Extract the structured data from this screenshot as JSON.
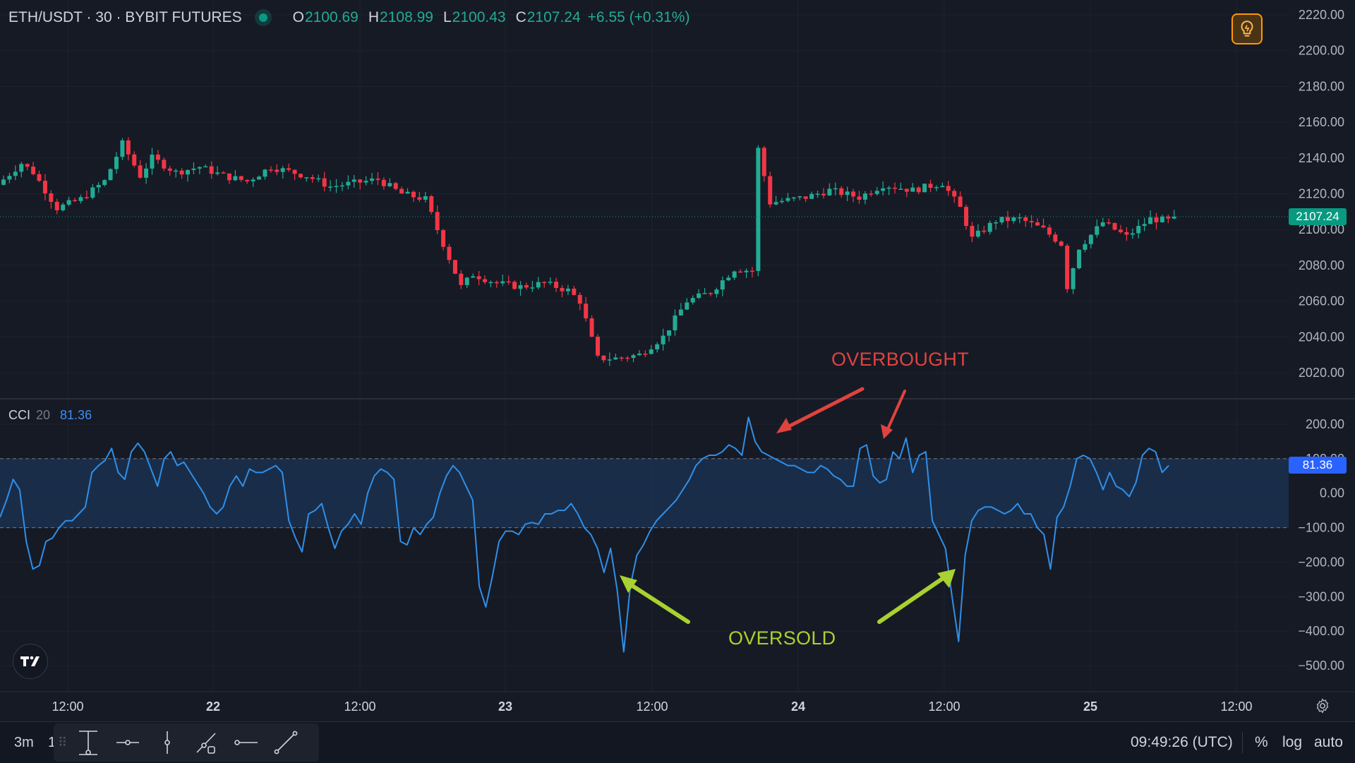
{
  "header": {
    "symbol": "ETH/USDT · 30 · BYBIT FUTURES",
    "open_label": "O",
    "open": "2100.69",
    "high_label": "H",
    "high": "2108.99",
    "low_label": "L",
    "low": "2100.43",
    "close_label": "C",
    "close": "2107.24",
    "change": "+6.55 (+0.31%)"
  },
  "price_axis": {
    "labels": [
      "2220.00",
      "2200.00",
      "2180.00",
      "2160.00",
      "2140.00",
      "2120.00",
      "2100.00",
      "2080.00",
      "2060.00",
      "2040.00",
      "2020.00"
    ],
    "last_price": "2107.24"
  },
  "cci": {
    "name": "CCI",
    "period": "20",
    "value": "81.36",
    "axis_labels": [
      "200.00",
      "100.00",
      "0.00",
      "−100.00",
      "−200.00",
      "−300.00",
      "−400.00",
      "−500.00"
    ]
  },
  "time_axis": {
    "labels": [
      "12:00",
      "22",
      "12:00",
      "23",
      "12:00",
      "24",
      "12:00",
      "25",
      "12:00"
    ]
  },
  "annotations": {
    "overbought": "OVERBOUGHT",
    "oversold": "OVERSOLD"
  },
  "bottom_bar": {
    "timeframes": [
      "3m",
      "1"
    ],
    "clock": "09:49:26 (UTC)",
    "percent": "%",
    "log": "log",
    "auto": "auto"
  },
  "colors": {
    "background": "#161a25",
    "up": "#22ab94",
    "down": "#f23645",
    "cci_line": "#2f8fe8",
    "overbought": "#f23645",
    "oversold": "#a9d12f",
    "alert_accent": "#ff9800"
  },
  "icons": {
    "alert": "lightbulb-icon",
    "logo": "tradingview-logo-icon",
    "settings": "gear-icon",
    "tools": [
      "cursor-measure-icon",
      "horizontal-ray-icon",
      "vertical-line-icon",
      "path-icon",
      "horizontal-line-icon",
      "trend-line-icon"
    ]
  },
  "chart_data": [
    {
      "type": "candlestick",
      "title": "ETH/USDT · 30 · BYBIT FUTURES",
      "ylim": [
        2010,
        2225
      ],
      "x_ticks": [
        "12:00",
        "22",
        "12:00",
        "23",
        "12:00",
        "24",
        "12:00",
        "25",
        "12:00"
      ],
      "last": 2107.24,
      "path_points": [
        [
          0,
          2125
        ],
        [
          4,
          2137
        ],
        [
          6,
          2132
        ],
        [
          10,
          2112
        ],
        [
          14,
          2117
        ],
        [
          18,
          2127
        ],
        [
          21,
          2148
        ],
        [
          24,
          2130
        ],
        [
          26,
          2140
        ],
        [
          30,
          2132
        ],
        [
          34,
          2135
        ],
        [
          38,
          2130
        ],
        [
          42,
          2127
        ],
        [
          46,
          2135
        ],
        [
          52,
          2130
        ],
        [
          56,
          2124
        ],
        [
          60,
          2126
        ],
        [
          64,
          2128
        ],
        [
          68,
          2120
        ],
        [
          72,
          2117
        ],
        [
          74,
          2100
        ],
        [
          76,
          2084
        ],
        [
          78,
          2068
        ],
        [
          80,
          2075
        ],
        [
          84,
          2070
        ],
        [
          88,
          2068
        ],
        [
          92,
          2070
        ],
        [
          96,
          2066
        ],
        [
          98,
          2060
        ],
        [
          101,
          2028
        ],
        [
          104,
          2028
        ],
        [
          108,
          2030
        ],
        [
          112,
          2040
        ],
        [
          116,
          2060
        ],
        [
          120,
          2065
        ],
        [
          124,
          2078
        ],
        [
          127,
          2077
        ],
        [
          128,
          2145
        ],
        [
          130,
          2115
        ],
        [
          136,
          2118
        ],
        [
          140,
          2122
        ],
        [
          145,
          2118
        ],
        [
          149,
          2125
        ],
        [
          154,
          2122
        ],
        [
          159,
          2126
        ],
        [
          162,
          2112
        ],
        [
          164,
          2095
        ],
        [
          168,
          2105
        ],
        [
          172,
          2106
        ],
        [
          176,
          2100
        ],
        [
          179,
          2092
        ],
        [
          180,
          2068
        ],
        [
          182,
          2090
        ],
        [
          186,
          2104
        ],
        [
          190,
          2096
        ],
        [
          194,
          2106
        ],
        [
          197,
          2105
        ]
      ]
    },
    {
      "type": "line",
      "title": "CCI 20",
      "ylim": [
        -560,
        230
      ],
      "bands": [
        100,
        -100
      ],
      "last": 81.36,
      "values": [
        -70,
        -20,
        40,
        10,
        -140,
        -220,
        -210,
        -140,
        -130,
        -100,
        -80,
        -80,
        -60,
        -40,
        60,
        80,
        95,
        130,
        60,
        40,
        120,
        145,
        120,
        70,
        20,
        100,
        120,
        80,
        90,
        60,
        30,
        0,
        -40,
        -60,
        -40,
        20,
        50,
        20,
        70,
        60,
        60,
        70,
        80,
        60,
        -80,
        -130,
        -170,
        -60,
        -50,
        -30,
        -100,
        -160,
        -110,
        -90,
        -60,
        -90,
        0,
        50,
        70,
        60,
        40,
        -140,
        -150,
        -100,
        -120,
        -90,
        -70,
        0,
        50,
        80,
        60,
        20,
        -20,
        -270,
        -330,
        -240,
        -140,
        -110,
        -110,
        -120,
        -90,
        -85,
        -90,
        -60,
        -60,
        -50,
        -50,
        -30,
        -60,
        -100,
        -120,
        -160,
        -230,
        -160,
        -280,
        -460,
        -270,
        -180,
        -150,
        -110,
        -80,
        -60,
        -40,
        -20,
        10,
        40,
        80,
        100,
        110,
        110,
        120,
        140,
        130,
        110,
        220,
        150,
        120,
        110,
        100,
        90,
        80,
        80,
        70,
        60,
        60,
        80,
        70,
        50,
        40,
        20,
        20,
        130,
        140,
        50,
        30,
        40,
        120,
        100,
        160,
        60,
        110,
        120,
        -80,
        -120,
        -160,
        -300,
        -430,
        -180,
        -80,
        -50,
        -40,
        -40,
        -50,
        -60,
        -50,
        -30,
        -60,
        -60,
        -100,
        -120,
        -220,
        -70,
        -40,
        20,
        100,
        110,
        100,
        60,
        10,
        60,
        20,
        10,
        -10,
        30,
        110,
        130,
        120,
        60,
        80
      ]
    }
  ]
}
